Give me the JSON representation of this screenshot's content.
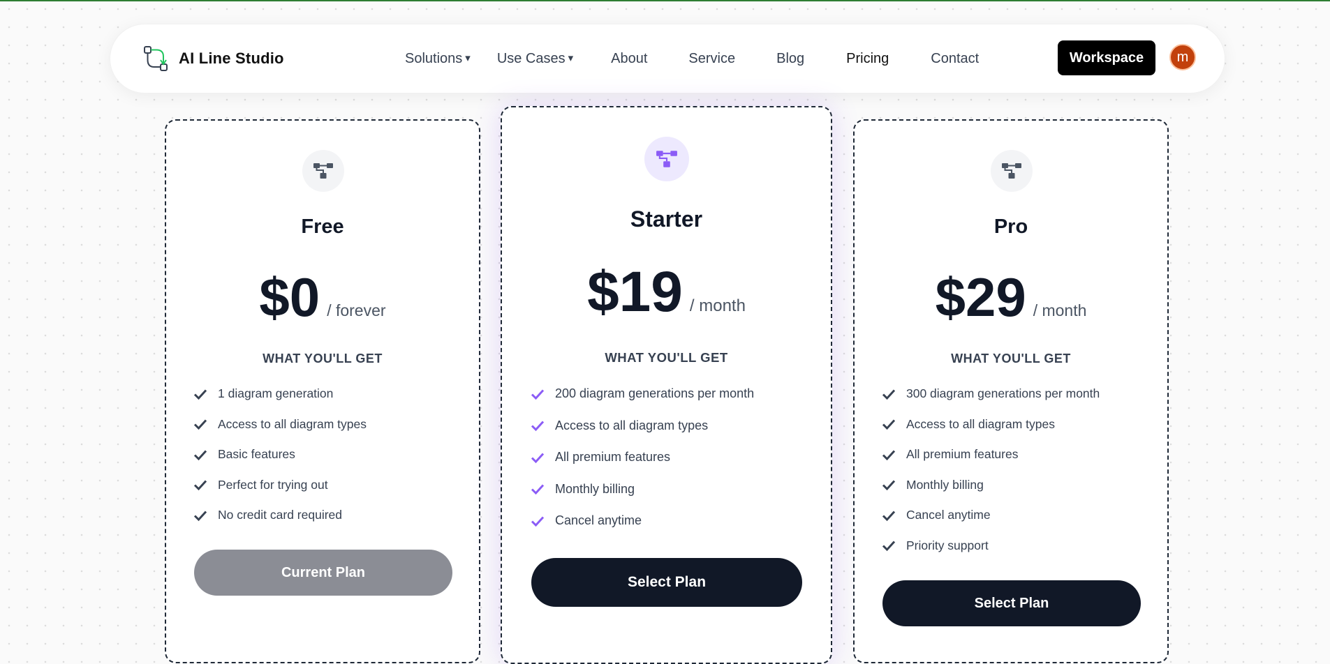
{
  "brand": {
    "name": "AI Line Studio"
  },
  "nav": {
    "items": [
      {
        "label": "Solutions",
        "caret": true
      },
      {
        "label": "Use Cases",
        "caret": true
      },
      {
        "label": "About",
        "caret": false
      },
      {
        "label": "Service",
        "caret": false
      },
      {
        "label": "Blog",
        "caret": false
      },
      {
        "label": "Pricing",
        "caret": false
      },
      {
        "label": "Contact",
        "caret": false
      }
    ],
    "caret_glyph": "▾",
    "workspace_label": "Workspace",
    "avatar_initial": "m"
  },
  "colors": {
    "accent": "#8b5cf6",
    "dark_button": "#111827",
    "disabled_button": "#8b8d95",
    "avatar": "#c2410c"
  },
  "section_label": "WHAT YOU'LL GET",
  "plans": [
    {
      "name": "Free",
      "price": "$0",
      "period": "/ forever",
      "features": [
        "1 diagram generation",
        "Access to all diagram types",
        "Basic features",
        "Perfect for trying out",
        "No credit card required"
      ],
      "button": "Current Plan",
      "icon": "diagram-icon"
    },
    {
      "name": "Starter",
      "price": "$19",
      "period": "/ month",
      "features": [
        "200 diagram generations per month",
        "Access to all diagram types",
        "All premium features",
        "Monthly billing",
        "Cancel anytime"
      ],
      "button": "Select Plan",
      "icon": "diagram-icon"
    },
    {
      "name": "Pro",
      "price": "$29",
      "period": "/ month",
      "features": [
        "300 diagram generations per month",
        "Access to all diagram types",
        "All premium features",
        "Monthly billing",
        "Cancel anytime",
        "Priority support"
      ],
      "button": "Select Plan",
      "icon": "diagram-icon"
    }
  ]
}
